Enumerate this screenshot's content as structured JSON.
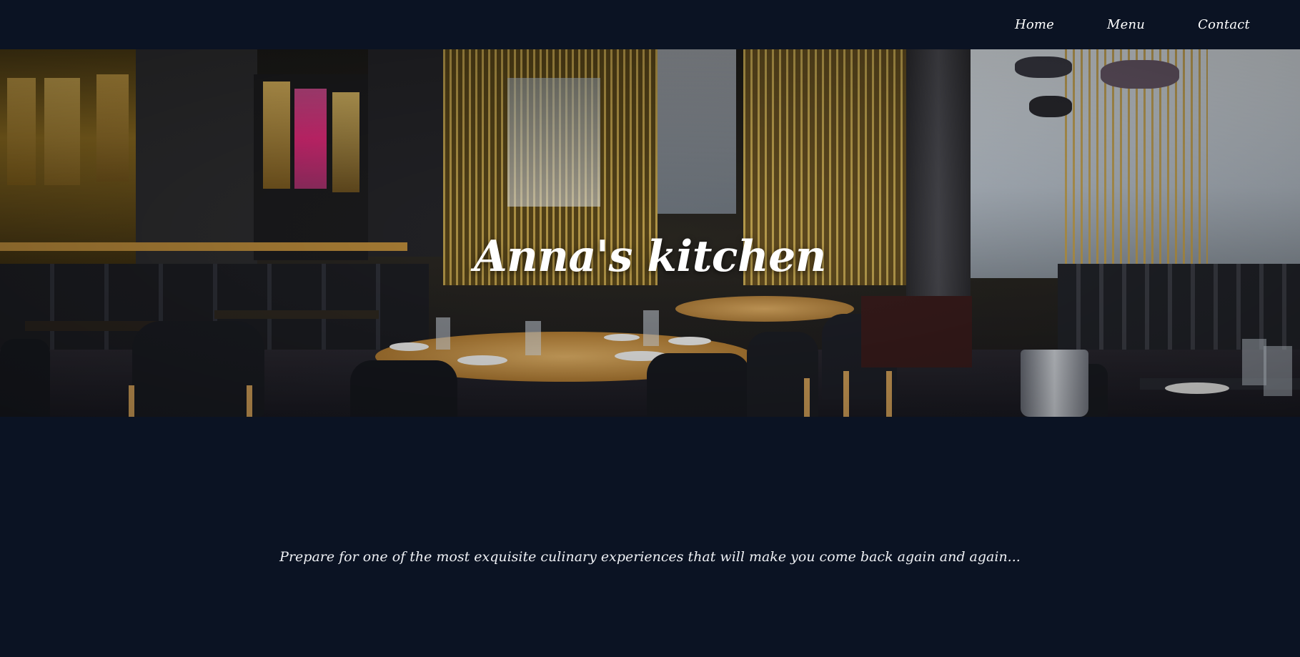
{
  "nav": {
    "items": [
      {
        "label": "Home"
      },
      {
        "label": "Menu"
      },
      {
        "label": "Contact"
      }
    ]
  },
  "hero": {
    "title": "Anna's kitchen"
  },
  "main": {
    "tagline": "Prepare for one of the most exquisite culinary experiences that will make you come back again and again..."
  },
  "colors": {
    "background": "#0b1323",
    "text": "#ffffff",
    "accent_gold": "#b99a45"
  }
}
